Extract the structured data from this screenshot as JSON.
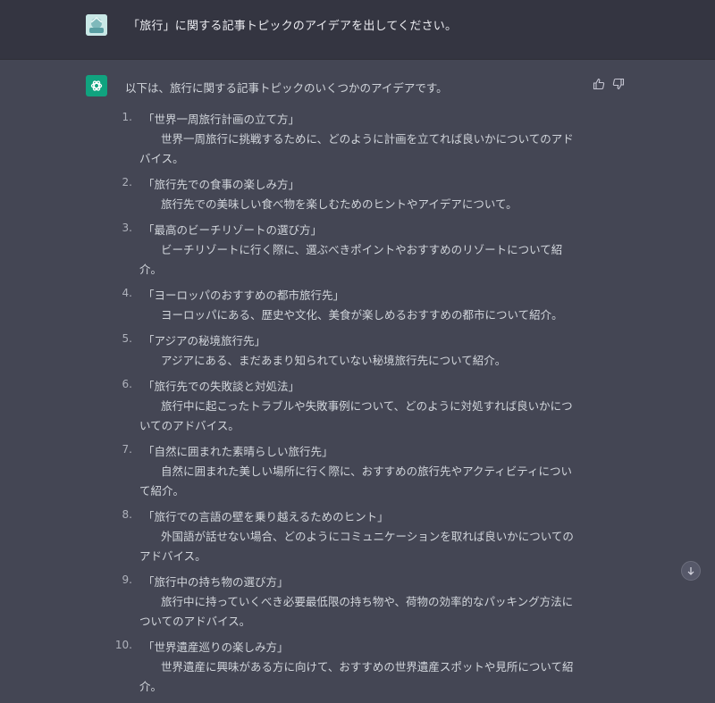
{
  "user_message": {
    "text": "「旅行」に関する記事トピックのアイデアを出してください。"
  },
  "assistant": {
    "intro": "以下は、旅行に関する記事トピックのいくつかのアイデアです。",
    "items": [
      {
        "num": "1.",
        "title": "「世界一周旅行計画の立て方」",
        "desc": "世界一周旅行に挑戦するために、どのように計画を立てれば良いかについてのアドバイス。"
      },
      {
        "num": "2.",
        "title": "「旅行先での食事の楽しみ方」",
        "desc": "旅行先での美味しい食べ物を楽しむためのヒントやアイデアについて。"
      },
      {
        "num": "3.",
        "title": "「最高のビーチリゾートの選び方」",
        "desc": "ビーチリゾートに行く際に、選ぶべきポイントやおすすめのリゾートについて紹介。"
      },
      {
        "num": "4.",
        "title": "「ヨーロッパのおすすめの都市旅行先」",
        "desc": "ヨーロッパにある、歴史や文化、美食が楽しめるおすすめの都市について紹介。"
      },
      {
        "num": "5.",
        "title": "「アジアの秘境旅行先」",
        "desc": "アジアにある、まだあまり知られていない秘境旅行先について紹介。"
      },
      {
        "num": "6.",
        "title": "「旅行先での失敗談と対処法」",
        "desc": "旅行中に起こったトラブルや失敗事例について、どのように対処すれば良いかについてのアドバイス。"
      },
      {
        "num": "7.",
        "title": "「自然に囲まれた素晴らしい旅行先」",
        "desc": "自然に囲まれた美しい場所に行く際に、おすすめの旅行先やアクティビティについて紹介。"
      },
      {
        "num": "8.",
        "title": "「旅行での言語の壁を乗り越えるためのヒント」",
        "desc": "外国語が話せない場合、どのようにコミュニケーションを取れば良いかについてのアドバイス。"
      },
      {
        "num": "9.",
        "title": "「旅行中の持ち物の選び方」",
        "desc": "旅行中に持っていくべき必要最低限の持ち物や、荷物の効率的なパッキング方法についてのアドバイス。"
      },
      {
        "num": "10.",
        "title": "「世界遺産巡りの楽しみ方」",
        "desc": "世界遺産に興味がある方に向けて、おすすめの世界遺産スポットや見所について紹介。"
      }
    ]
  },
  "icons": {
    "user_avatar": "user-avatar-icon",
    "bot_avatar": "openai-logo-icon",
    "thumbs_up": "thumbs-up-icon",
    "thumbs_down": "thumbs-down-icon",
    "scroll_down": "arrow-down-icon"
  },
  "colors": {
    "accent": "#10a37f",
    "user_bg": "#343541",
    "assistant_bg": "#444654"
  }
}
